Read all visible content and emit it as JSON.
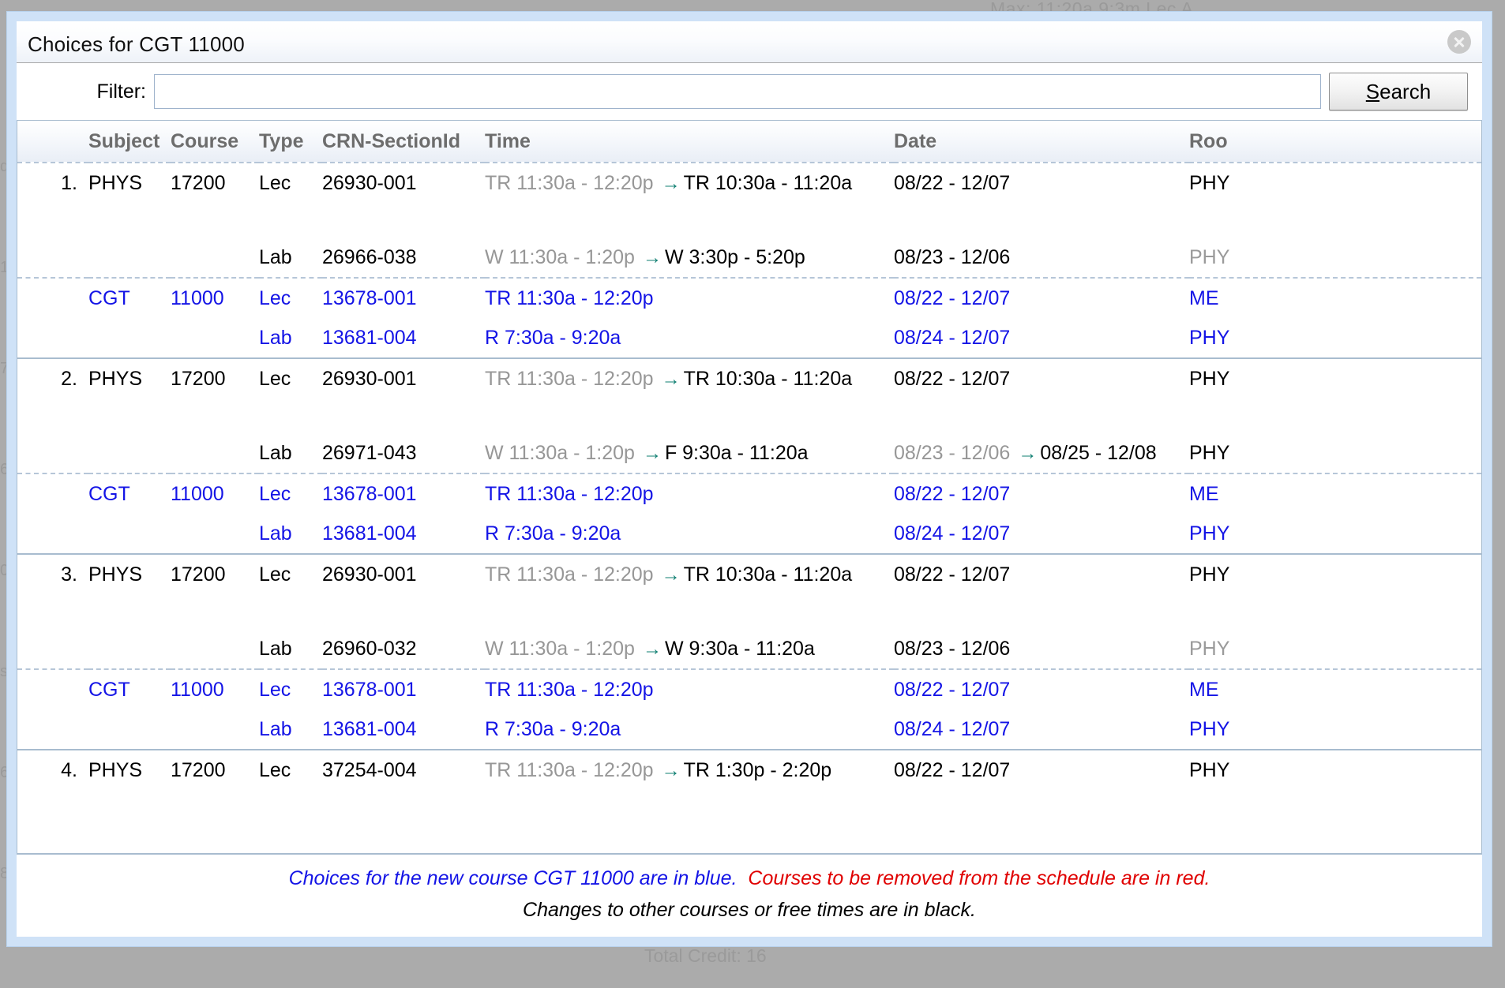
{
  "background": {
    "top_ghost": "Max: 11:20a 9:3m  Lec A",
    "bottom_ghost": "Total Credit: 16",
    "left_ghosts": [
      "d",
      "1",
      "7",
      "6",
      "0",
      "s",
      "6",
      "8"
    ]
  },
  "dialog": {
    "title": "Choices for CGT 11000",
    "close_icon": "close-circle-icon"
  },
  "filter": {
    "label": "Filter:",
    "value": "",
    "placeholder": ""
  },
  "search_button": {
    "accel": "S",
    "rest": "earch"
  },
  "table": {
    "columns": [
      "",
      "Subject",
      "Course",
      "Type",
      "CRN-SectionId",
      "Time",
      "Date",
      "Roo"
    ],
    "groups": [
      {
        "index": "1.",
        "rows": [
          {
            "subject": "PHYS",
            "course": "17200",
            "type": "Lec",
            "crn": "26930-001",
            "time_old": "TR 11:30a - 12:20p",
            "time_new": "TR 10:30a - 11:20a",
            "date_old": "",
            "date_new": "08/22 - 12/07",
            "room": "PHY",
            "room_gray": false,
            "blue": false
          },
          {
            "spacer": true
          },
          {
            "subject": "",
            "course": "",
            "type": "Lab",
            "crn": "26966-038",
            "time_old": "W 11:30a - 1:20p",
            "time_new": "W 3:30p - 5:20p",
            "date_old": "",
            "date_new": "08/23 - 12/06",
            "room": "PHY",
            "room_gray": true,
            "blue": false
          },
          {
            "subject": "CGT",
            "course": "11000",
            "type": "Lec",
            "crn": "13678-001",
            "time_old": "",
            "time_new": "TR 11:30a - 12:20p",
            "date_old": "",
            "date_new": "08/22 - 12/07",
            "room": "ME ",
            "room_gray": false,
            "blue": true,
            "dash_top": true
          },
          {
            "subject": "",
            "course": "",
            "type": "Lab",
            "crn": "13681-004",
            "time_old": "",
            "time_new": "R 7:30a - 9:20a",
            "date_old": "",
            "date_new": "08/24 - 12/07",
            "room": "PHY",
            "room_gray": false,
            "blue": true,
            "group_end": true
          }
        ]
      },
      {
        "index": "2.",
        "rows": [
          {
            "subject": "PHYS",
            "course": "17200",
            "type": "Lec",
            "crn": "26930-001",
            "time_old": "TR 11:30a - 12:20p",
            "time_new": "TR 10:30a - 11:20a",
            "date_old": "",
            "date_new": "08/22 - 12/07",
            "room": "PHY",
            "room_gray": false,
            "blue": false
          },
          {
            "spacer": true
          },
          {
            "subject": "",
            "course": "",
            "type": "Lab",
            "crn": "26971-043",
            "time_old": "W 11:30a - 1:20p",
            "time_new": "F 9:30a - 11:20a",
            "date_old": "08/23 - 12/06",
            "date_new": "08/25 - 12/08",
            "room": "PHY",
            "room_gray": false,
            "blue": false
          },
          {
            "subject": "CGT",
            "course": "11000",
            "type": "Lec",
            "crn": "13678-001",
            "time_old": "",
            "time_new": "TR 11:30a - 12:20p",
            "date_old": "",
            "date_new": "08/22 - 12/07",
            "room": "ME ",
            "room_gray": false,
            "blue": true,
            "dash_top": true
          },
          {
            "subject": "",
            "course": "",
            "type": "Lab",
            "crn": "13681-004",
            "time_old": "",
            "time_new": "R 7:30a - 9:20a",
            "date_old": "",
            "date_new": "08/24 - 12/07",
            "room": "PHY",
            "room_gray": false,
            "blue": true,
            "group_end": true
          }
        ]
      },
      {
        "index": "3.",
        "rows": [
          {
            "subject": "PHYS",
            "course": "17200",
            "type": "Lec",
            "crn": "26930-001",
            "time_old": "TR 11:30a - 12:20p",
            "time_new": "TR 10:30a - 11:20a",
            "date_old": "",
            "date_new": "08/22 - 12/07",
            "room": "PHY",
            "room_gray": false,
            "blue": false
          },
          {
            "spacer": true
          },
          {
            "subject": "",
            "course": "",
            "type": "Lab",
            "crn": "26960-032",
            "time_old": "W 11:30a - 1:20p",
            "time_new": "W 9:30a - 11:20a",
            "date_old": "",
            "date_new": "08/23 - 12/06",
            "room": "PHY",
            "room_gray": true,
            "blue": false
          },
          {
            "subject": "CGT",
            "course": "11000",
            "type": "Lec",
            "crn": "13678-001",
            "time_old": "",
            "time_new": "TR 11:30a - 12:20p",
            "date_old": "",
            "date_new": "08/22 - 12/07",
            "room": "ME ",
            "room_gray": false,
            "blue": true,
            "dash_top": true
          },
          {
            "subject": "",
            "course": "",
            "type": "Lab",
            "crn": "13681-004",
            "time_old": "",
            "time_new": "R 7:30a - 9:20a",
            "date_old": "",
            "date_new": "08/24 - 12/07",
            "room": "PHY",
            "room_gray": false,
            "blue": true,
            "group_end": true
          }
        ]
      },
      {
        "index": "4.",
        "rows": [
          {
            "subject": "PHYS",
            "course": "17200",
            "type": "Lec",
            "crn": "37254-004",
            "time_old": "TR 11:30a - 12:20p",
            "time_new": "TR 1:30p - 2:20p",
            "date_old": "",
            "date_new": "08/22 - 12/07",
            "room": "PHY",
            "room_gray": false,
            "blue": false
          }
        ]
      }
    ]
  },
  "legend": {
    "line1_blue": "Choices for the new course CGT 11000 are in blue.",
    "line1_red": "Courses to be removed from the schedule are in red.",
    "line2": "Changes to other courses or free times are in black."
  },
  "colors": {
    "blue": "#1414e6",
    "red": "#e00000",
    "arrow_teal": "#0f7f72",
    "old_gray": "#979797",
    "dialog_border": "#cfe2f7"
  }
}
